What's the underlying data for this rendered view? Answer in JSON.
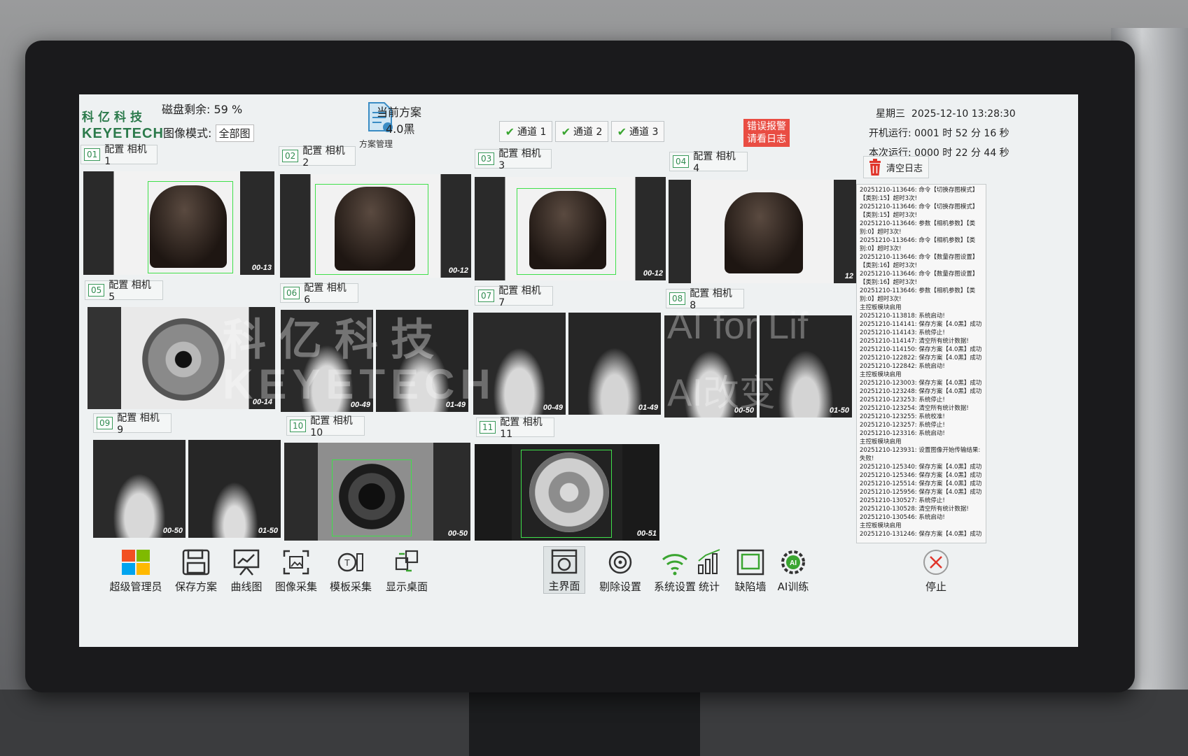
{
  "brand": {
    "cn": "科亿科技",
    "en": "KEYETECH"
  },
  "header": {
    "disk_label": "磁盘剩余:",
    "disk_value": "59 %",
    "mode_label": "图像模式:",
    "mode_value": "全部图",
    "scheme_manage": "方案管理",
    "current_scheme_label": "当前方案",
    "current_scheme_value": "4.0黑",
    "channels": [
      "通道 1",
      "通道 2",
      "通道 3"
    ],
    "alarm_line1": "错误报警",
    "alarm_line2": "请看日志",
    "weekday": "星期三",
    "datetime": "2025-12-10  13:28:30",
    "boot_run": "开机运行:  0001 时 52 分 16 秒",
    "this_run": "本次运行:  0000 时 22 分 44 秒"
  },
  "cameras": [
    {
      "num": "01",
      "label": "配置 相机1",
      "tags": [
        "00-13"
      ]
    },
    {
      "num": "02",
      "label": "配置 相机2",
      "tags": [
        "00-12"
      ]
    },
    {
      "num": "03",
      "label": "配置 相机3",
      "tags": [
        "00-12"
      ]
    },
    {
      "num": "04",
      "label": "配置 相机4",
      "tags": [
        "12"
      ]
    },
    {
      "num": "05",
      "label": "配置 相机5",
      "tags": [
        "00-14"
      ]
    },
    {
      "num": "06",
      "label": "配置 相机6",
      "tags": [
        "00-49",
        "01-49"
      ]
    },
    {
      "num": "07",
      "label": "配置 相机7",
      "tags": [
        "00-49",
        "01-49"
      ]
    },
    {
      "num": "08",
      "label": "配置 相机8",
      "tags": [
        "00-50",
        "01-50"
      ]
    },
    {
      "num": "09",
      "label": "配置 相机9",
      "tags": [
        "00-50",
        "01-50"
      ]
    },
    {
      "num": "10",
      "label": "配置 相机10",
      "tags": [
        "00-50"
      ]
    },
    {
      "num": "11",
      "label": "配置 相机11",
      "tags": [
        "00-51"
      ]
    }
  ],
  "watermark": {
    "cn": "科亿科技",
    "en": "KEYETECH",
    "ai": "AI for Lif",
    "ai_cn": "AI改变"
  },
  "log": {
    "clear_label": "清空日志",
    "lines": [
      "20251210-113646: 命令【切换存图模式】【类别:15】超时3次!",
      "20251210-113646: 命令【切换存图模式】【类别:15】超时3次!",
      "20251210-113646: 参数【相机参数】【类别:0】超时3次!",
      "20251210-113646: 命令【相机参数】【类别:0】超时3次!",
      "20251210-113646: 命令【数量存图设置】【类别:16】超时3次!",
      "20251210-113646: 命令【数量存图设置】【类别:16】超时3次!",
      "20251210-113646: 参数【相机参数】【类别:0】超时3次!",
      "主控板模块启用",
      "20251210-113818: 系统启动!",
      "20251210-114141: 保存方案【4.0黑】成功",
      "20251210-114143: 系统停止!",
      "20251210-114147: 清空所有统计数据!",
      "20251210-114150: 保存方案【4.0黑】成功",
      "20251210-122822: 保存方案【4.0黑】成功",
      "20251210-122842: 系统启动!",
      "主控板模块启用",
      "20251210-123003: 保存方案【4.0黑】成功",
      "20251210-123248: 保存方案【4.0黑】成功",
      "20251210-123253: 系统停止!",
      "20251210-123254: 清空所有统计数据!",
      "20251210-123255: 系统校准!",
      "20251210-123257: 系统停止!",
      "20251210-123316: 系统启动!",
      "主控板模块启用",
      "20251210-123931: 设置图像开始传输结果: 失败!",
      "20251210-125340: 保存方案【4.0黑】成功",
      "20251210-125346: 保存方案【4.0黑】成功",
      "20251210-125514: 保存方案【4.0黑】成功",
      "20251210-125956: 保存方案【4.0黑】成功",
      "20251210-130527: 系统停止!",
      "20251210-130528: 清空所有统计数据!",
      "20251210-130546: 系统启动!",
      "主控板模块启用",
      "20251210-131246: 保存方案【4.0黑】成功"
    ]
  },
  "toolbar": {
    "super_admin": "超级管理员",
    "save_scheme": "保存方案",
    "curve": "曲线图",
    "image_capture": "图像采集",
    "template_capture": "模板采集",
    "show_desktop": "显示桌面",
    "main": "主界面",
    "reject": "剔除设置",
    "system": "系统设置",
    "stats": "统计",
    "defect_wall": "缺陷墙",
    "ai_train": "AI训练",
    "stop": "停止"
  },
  "colors": {
    "accent": "#2b7a4b",
    "alarm": "#e94d43",
    "box": "#3fe04a"
  }
}
